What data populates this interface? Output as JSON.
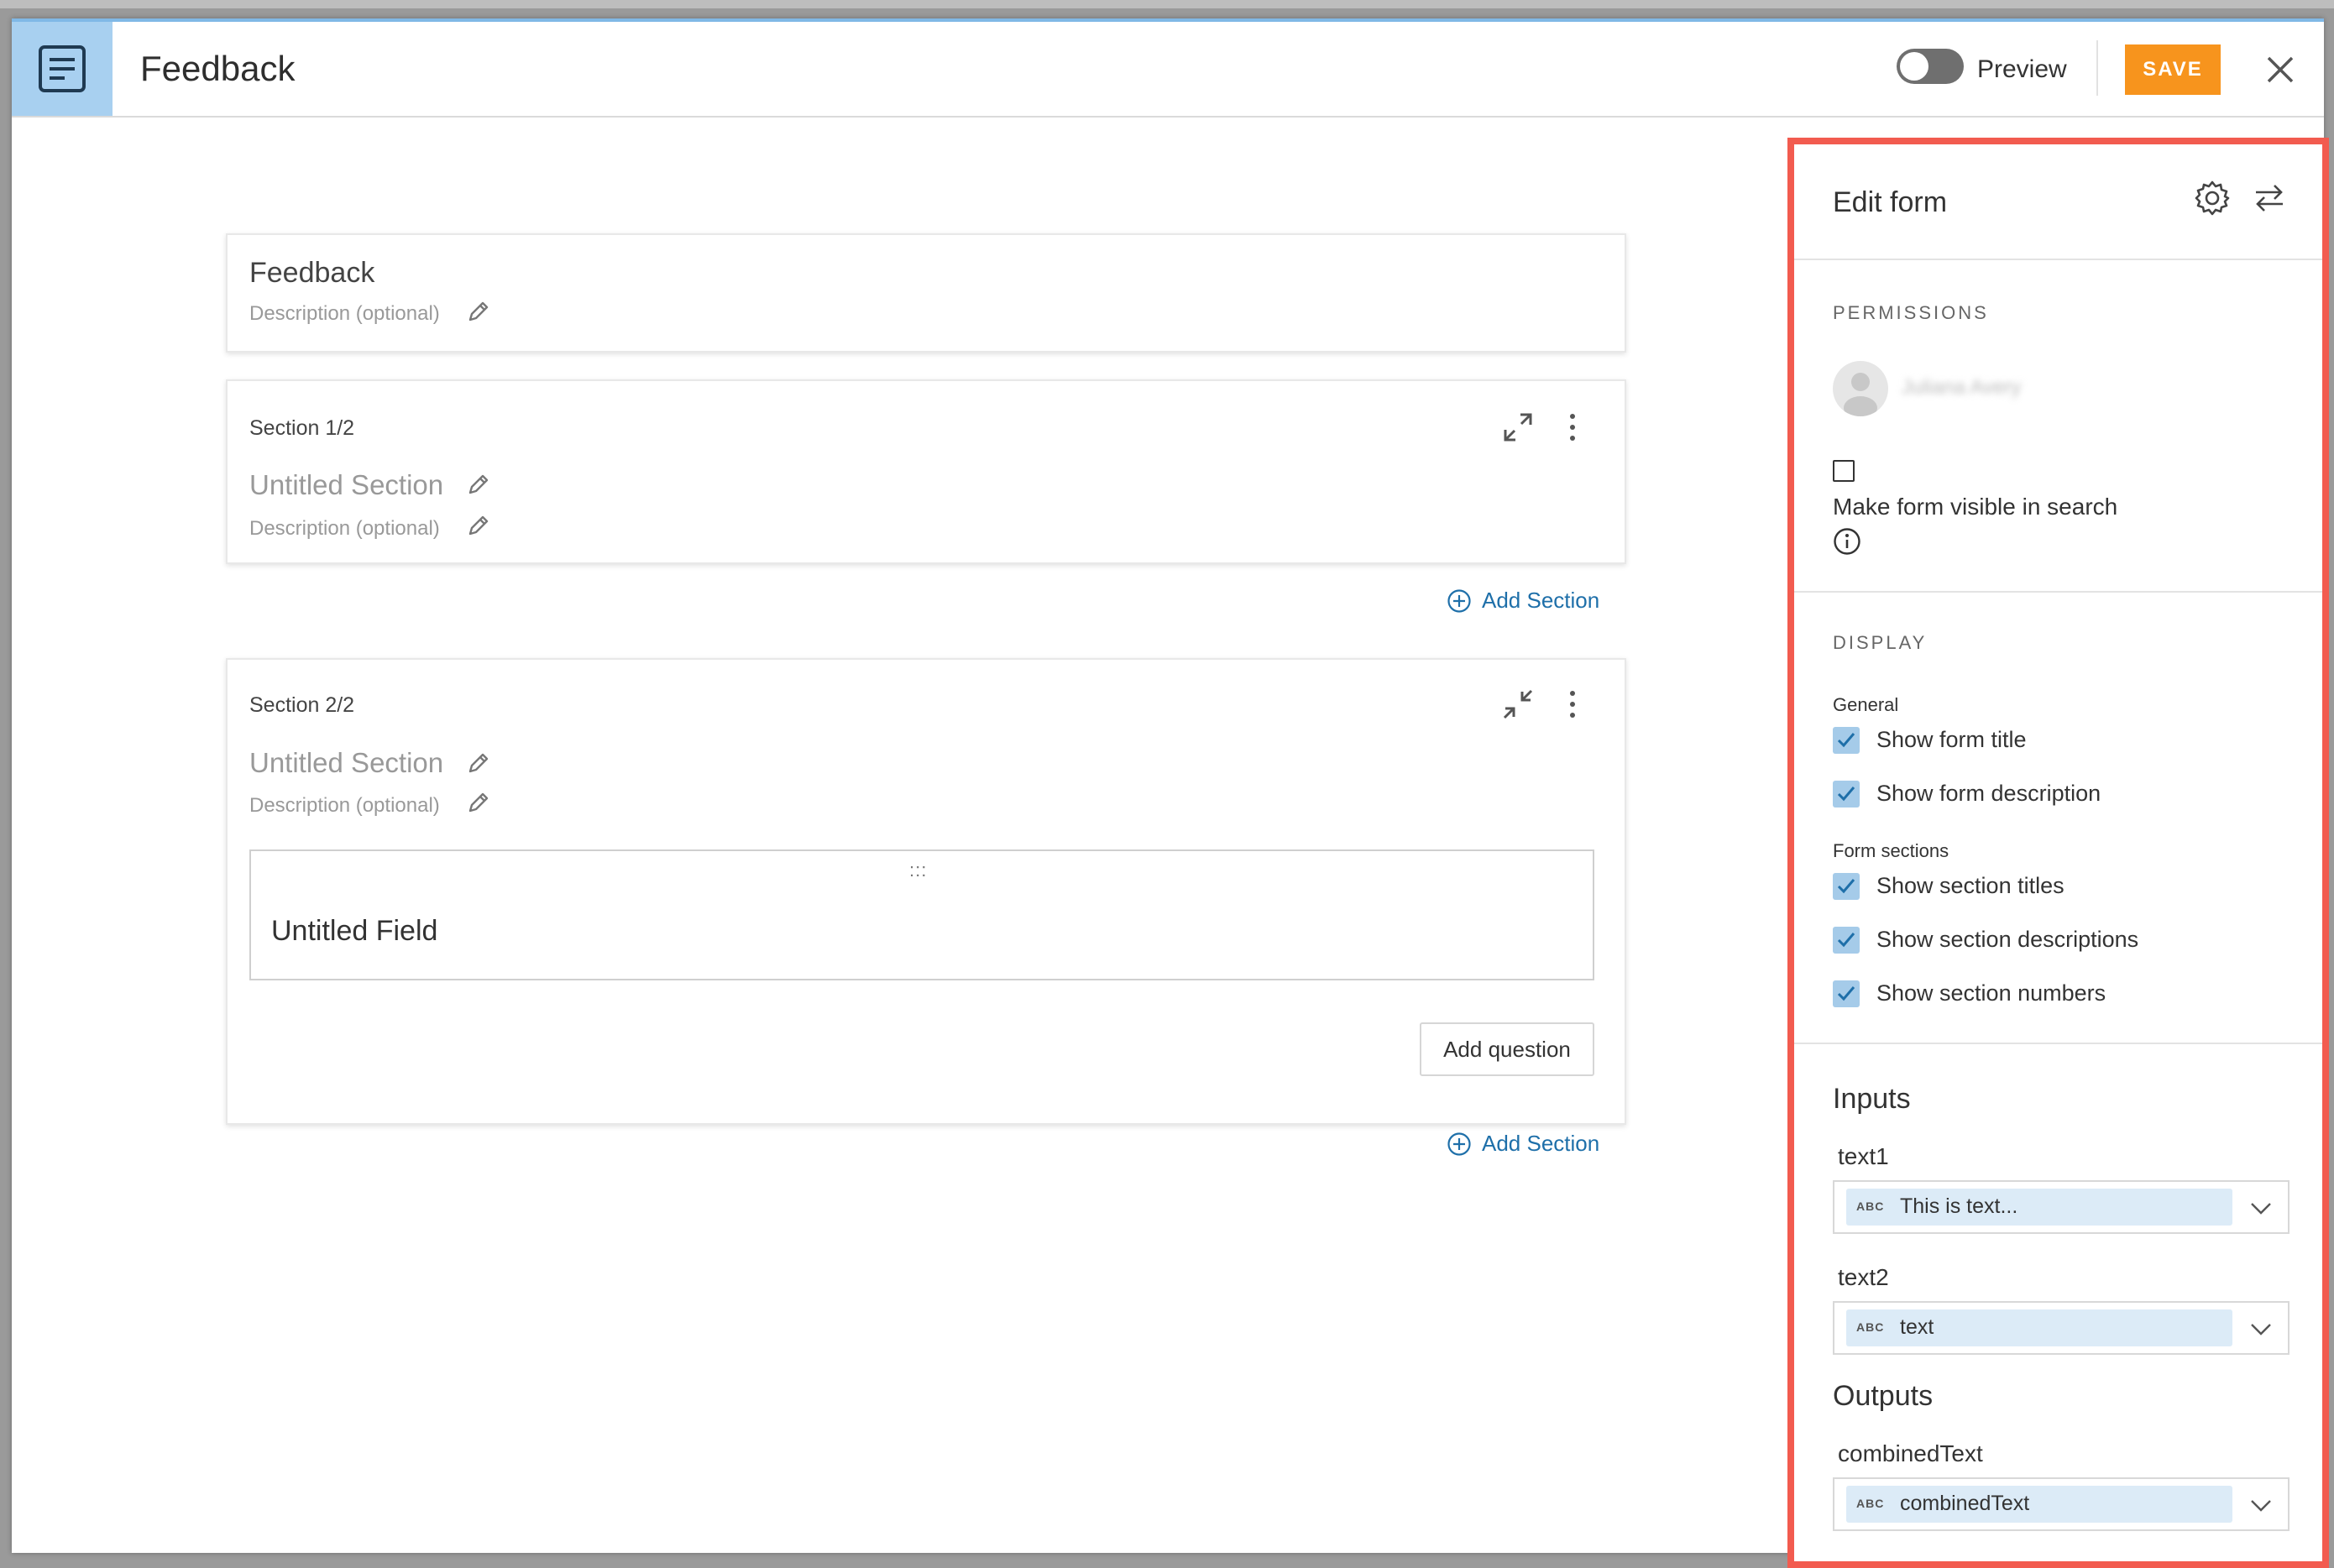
{
  "header": {
    "app_title": "Feedback",
    "preview_label": "Preview",
    "save_label": "SAVE"
  },
  "form": {
    "title": "Feedback",
    "description_placeholder": "Description (optional)",
    "sections": [
      {
        "label": "Section 1/2",
        "title": "Untitled Section",
        "description": "Description (optional)",
        "expanded": false
      },
      {
        "label": "Section 2/2",
        "title": "Untitled Section",
        "description": "Description (optional)",
        "expanded": true,
        "field_title": "Untitled Field",
        "drag_handle": ":::",
        "add_question_label": "Add question"
      }
    ],
    "add_section_label": "Add Section"
  },
  "panel": {
    "title": "Edit form",
    "permissions_heading": "PERMISSIONS",
    "user_name": "Juliana Avery",
    "visible_in_search_label": "Make form visible in search",
    "visible_in_search_checked": false,
    "display_heading": "DISPLAY",
    "general_label": "General",
    "general_options": [
      {
        "label": "Show form title",
        "checked": true
      },
      {
        "label": "Show form description",
        "checked": true
      }
    ],
    "form_sections_label": "Form sections",
    "section_options": [
      {
        "label": "Show section titles",
        "checked": true
      },
      {
        "label": "Show section descriptions",
        "checked": true
      },
      {
        "label": "Show section numbers",
        "checked": true
      }
    ],
    "inputs_heading": "Inputs",
    "inputs": [
      {
        "name": "text1",
        "type_badge": "ABC",
        "value": "This is text..."
      },
      {
        "name": "text2",
        "type_badge": "ABC",
        "value": "text"
      }
    ],
    "outputs_heading": "Outputs",
    "outputs": [
      {
        "name": "combinedText",
        "type_badge": "ABC",
        "value": "combinedText"
      }
    ]
  },
  "colors": {
    "accent_save": "#f7941d",
    "panel_highlight": "#f25b4f",
    "link_blue": "#1e6fa9",
    "header_tile": "#a8d0f0",
    "checkbox_fill": "#a5cbe9"
  }
}
